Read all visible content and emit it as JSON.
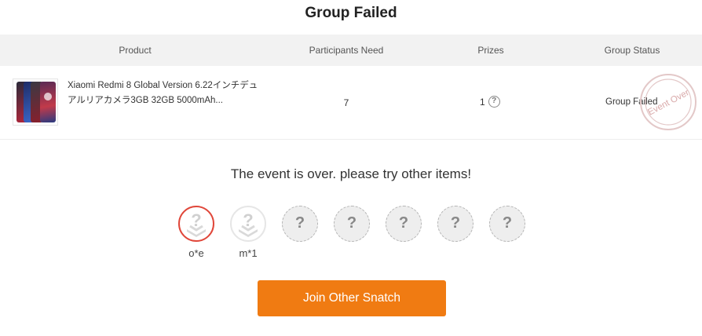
{
  "page": {
    "title": "Group Failed"
  },
  "table": {
    "headers": {
      "product": "Product",
      "participants": "Participants Need",
      "prizes": "Prizes",
      "status": "Group Status"
    },
    "row": {
      "product_name": "Xiaomi Redmi 8 Global Version 6.22インチデュアルリアカメラ3GB 32GB 5000mAh...",
      "participants_need": "7",
      "prizes": "1",
      "prizes_help_icon": "question-circle-icon",
      "group_status": "Group Failed",
      "stamp_text": "Event Over"
    }
  },
  "message": "The event is over. please try other items!",
  "participants": {
    "slots": [
      {
        "name": "o*e",
        "state": "joined",
        "role": "host"
      },
      {
        "name": "m*1",
        "state": "joined",
        "role": "member"
      },
      {
        "state": "empty",
        "placeholder": "?"
      },
      {
        "state": "empty",
        "placeholder": "?"
      },
      {
        "state": "empty",
        "placeholder": "?"
      },
      {
        "state": "empty",
        "placeholder": "?"
      },
      {
        "state": "empty",
        "placeholder": "?"
      }
    ]
  },
  "join_button": {
    "label": "Join Other Snatch"
  },
  "colors": {
    "accent": "#f07b12",
    "host_ring": "#e0473a",
    "header_bg": "#f2f2f2",
    "stamp": "#e3bcbc"
  }
}
